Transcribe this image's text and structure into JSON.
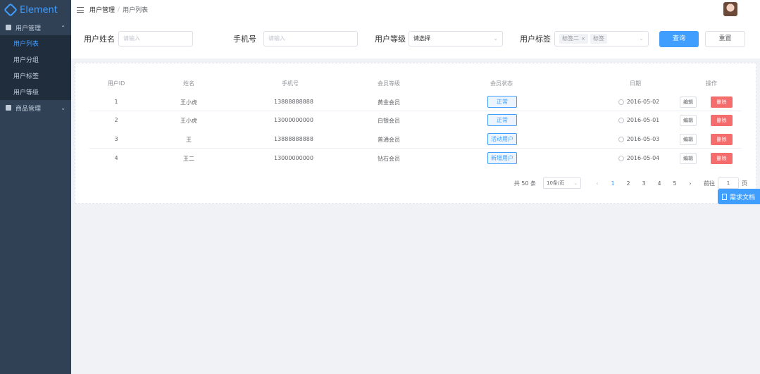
{
  "app": {
    "logo_text": "Element"
  },
  "sidebar": {
    "groups": [
      {
        "label": "用户管理",
        "icon": "user-icon",
        "expanded": true,
        "items": [
          {
            "label": "用户列表",
            "active": true
          },
          {
            "label": "用户分组",
            "active": false
          },
          {
            "label": "用户标签",
            "active": false
          },
          {
            "label": "用户等级",
            "active": false
          }
        ]
      },
      {
        "label": "商品管理",
        "icon": "goods-icon",
        "expanded": false,
        "items": []
      }
    ]
  },
  "header": {
    "breadcrumb": [
      "用户管理",
      "用户列表"
    ]
  },
  "filter": {
    "name_label": "用户姓名",
    "name_placeholder": "请输入",
    "phone_label": "手机号",
    "phone_placeholder": "请输入",
    "level_label": "用户等级",
    "level_value": "请选择",
    "tags_label": "用户标签",
    "tags": [
      "标签二",
      "标签"
    ],
    "search_label": "查询",
    "reset_label": "重置"
  },
  "table": {
    "columns": [
      "用户ID",
      "姓名",
      "手机号",
      "会员等级",
      "会员状态",
      "日期",
      "操作"
    ],
    "rows": [
      {
        "id": "1",
        "name": "王小虎",
        "phone": "13888888888",
        "level": "黄金会员",
        "status": "正常",
        "date": "2016-05-02"
      },
      {
        "id": "2",
        "name": "王小虎",
        "phone": "13000000000",
        "level": "白银会员",
        "status": "正常",
        "date": "2016-05-01"
      },
      {
        "id": "3",
        "name": "王",
        "phone": "13888888888",
        "level": "普通会员",
        "status": "活动用户",
        "date": "2016-05-03"
      },
      {
        "id": "4",
        "name": "王二",
        "phone": "13000000000",
        "level": "钻石会员",
        "status": "新增用户",
        "date": "2016-05-04"
      }
    ],
    "edit_label": "编辑",
    "delete_label": "删除"
  },
  "pagination": {
    "total_text": "共 50 条",
    "page_size": "10条/页",
    "prev": "‹",
    "pages": [
      "1",
      "2",
      "3",
      "4",
      "5"
    ],
    "current": "1",
    "next": "›",
    "goto_label": "前往",
    "goto_value": "1",
    "goto_suffix": "页"
  },
  "doc_button": {
    "label": "需求文档"
  },
  "colors": {
    "primary": "#409eff",
    "danger": "#f56c6c",
    "sidebar": "#304156"
  }
}
